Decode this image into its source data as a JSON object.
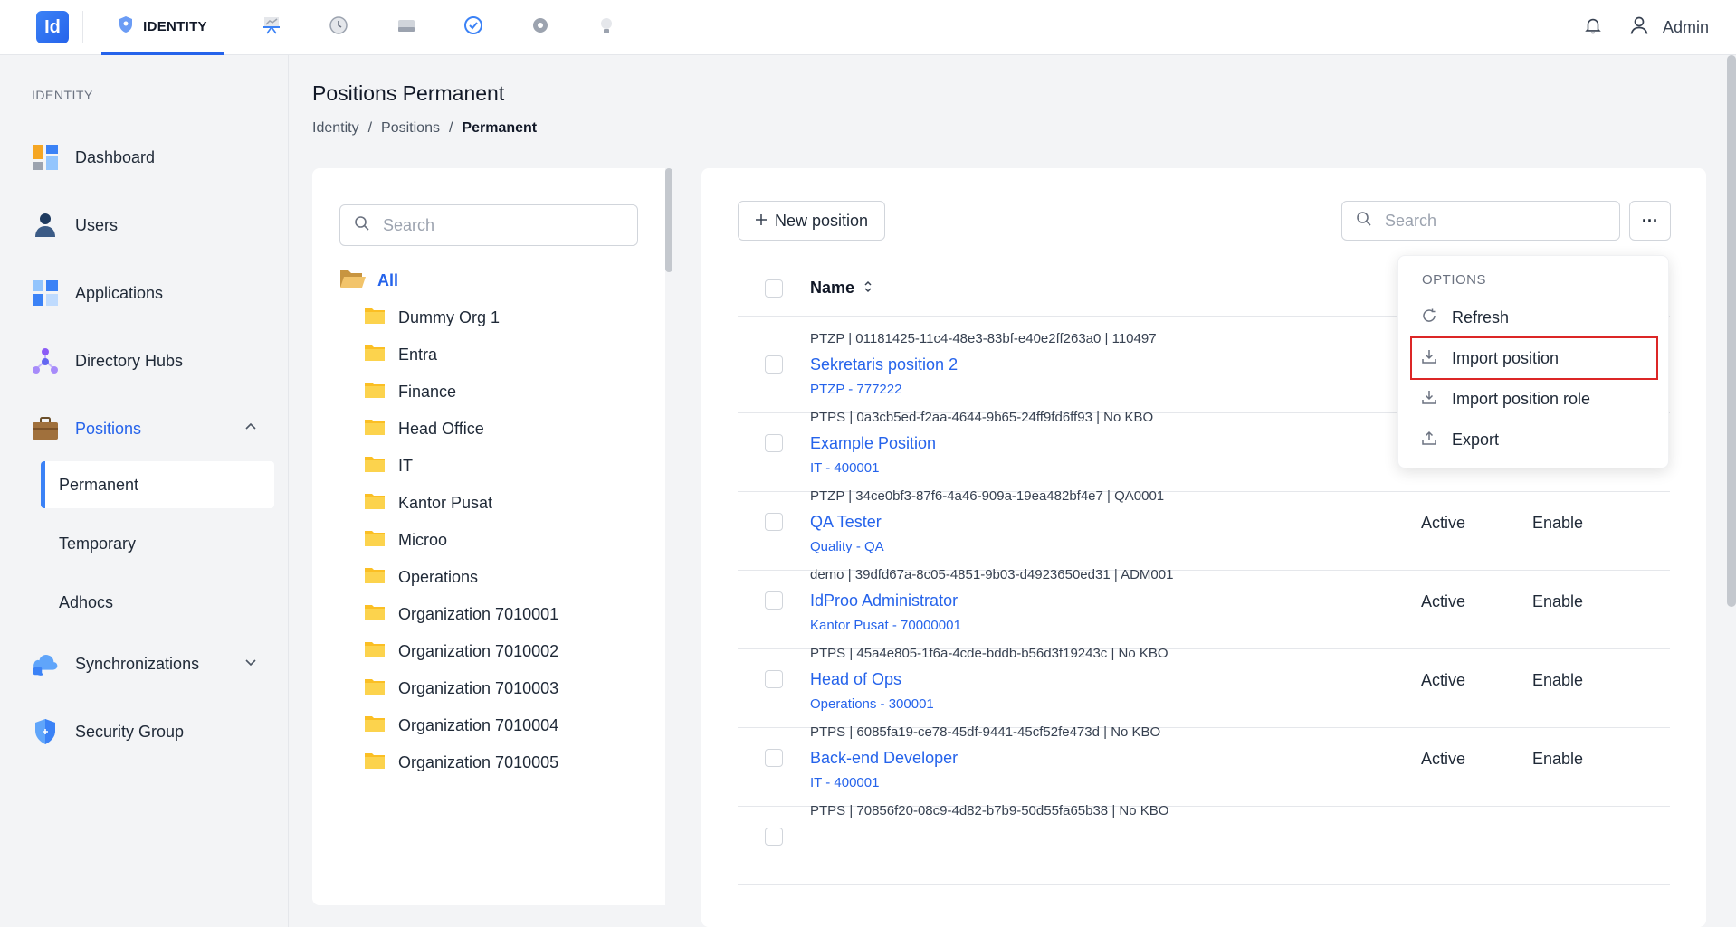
{
  "app": {
    "logo_text": "Id",
    "module_label": "IDENTITY",
    "accent": "#2563eb",
    "user_name": "Admin"
  },
  "module_icons": [
    "chart-presentation-icon",
    "history-icon",
    "drive-icon",
    "badge-check-icon",
    "gear-icon",
    "bulb-icon"
  ],
  "sidebar": {
    "section": "IDENTITY",
    "items": [
      {
        "label": "Dashboard",
        "icon": "dashboard-icon"
      },
      {
        "label": "Users",
        "icon": "user-icon"
      },
      {
        "label": "Applications",
        "icon": "apps-grid-icon"
      },
      {
        "label": "Directory Hubs",
        "icon": "hub-icon"
      },
      {
        "label": "Positions",
        "icon": "briefcase-icon"
      },
      {
        "label": "Synchronizations",
        "icon": "cloud-sync-icon"
      },
      {
        "label": "Security Group",
        "icon": "shield-icon"
      }
    ],
    "positions_sub": [
      {
        "label": "Permanent"
      },
      {
        "label": "Temporary"
      },
      {
        "label": "Adhocs"
      }
    ]
  },
  "page": {
    "title": "Positions Permanent",
    "breadcrumb": [
      "Identity",
      "Positions",
      "Permanent"
    ],
    "breadcrumb_sep": "/"
  },
  "tree": {
    "search_placeholder": "Search",
    "root_label": "All",
    "nodes": [
      "Dummy Org 1",
      "Entra",
      "Finance",
      "Head Office",
      "IT",
      "Kantor Pusat",
      "Microo",
      "Operations",
      "Organization 7010001",
      "Organization 7010002",
      "Organization 7010003",
      "Organization 7010004",
      "Organization 7010005"
    ]
  },
  "list": {
    "new_button": "New position",
    "search_placeholder": "Search",
    "more_button": "···",
    "column_name": "Name",
    "rows": [
      {
        "meta": "PTZP | 01181425-11c4-48e3-83bf-e40e2ff263a0 | 110497",
        "name": "Sekretaris position 2",
        "sub": "PTZP - 777222",
        "status": "",
        "enable": ""
      },
      {
        "meta": "PTPS | 0a3cb5ed-f2aa-4644-9b65-24ff9fd6ff93 | No KBO",
        "name": "Example Position",
        "sub": "IT - 400001",
        "status": "",
        "enable": ""
      },
      {
        "meta": "PTZP | 34ce0bf3-87f6-4a46-909a-19ea482bf4e7 | QA0001",
        "name": "QA Tester",
        "sub": "Quality - QA",
        "status": "Active",
        "enable": "Enable"
      },
      {
        "meta": "demo | 39dfd67a-8c05-4851-9b03-d4923650ed31 | ADM001",
        "name": "IdProo Administrator",
        "sub": "Kantor Pusat - 70000001",
        "status": "Active",
        "enable": "Enable"
      },
      {
        "meta": "PTPS | 45a4e805-1f6a-4cde-bddb-b56d3f19243c | No KBO",
        "name": "Head of Ops",
        "sub": "Operations - 300001",
        "status": "Active",
        "enable": "Enable"
      },
      {
        "meta": "PTPS | 6085fa19-ce78-45df-9441-45cf52fe473d | No KBO",
        "name": "Back-end Developer",
        "sub": "IT - 400001",
        "status": "Active",
        "enable": "Enable"
      },
      {
        "meta": "PTPS | 70856f20-08c9-4d82-b7b9-50d55fa65b38 | No KBO",
        "name": "",
        "sub": "",
        "status": "",
        "enable": ""
      }
    ]
  },
  "options_menu": {
    "header": "OPTIONS",
    "items": [
      {
        "label": "Refresh",
        "icon": "refresh-icon"
      },
      {
        "label": "Import position",
        "icon": "download-icon",
        "highlighted": true
      },
      {
        "label": "Import position role",
        "icon": "download-icon"
      },
      {
        "label": "Export",
        "icon": "upload-icon"
      }
    ]
  }
}
